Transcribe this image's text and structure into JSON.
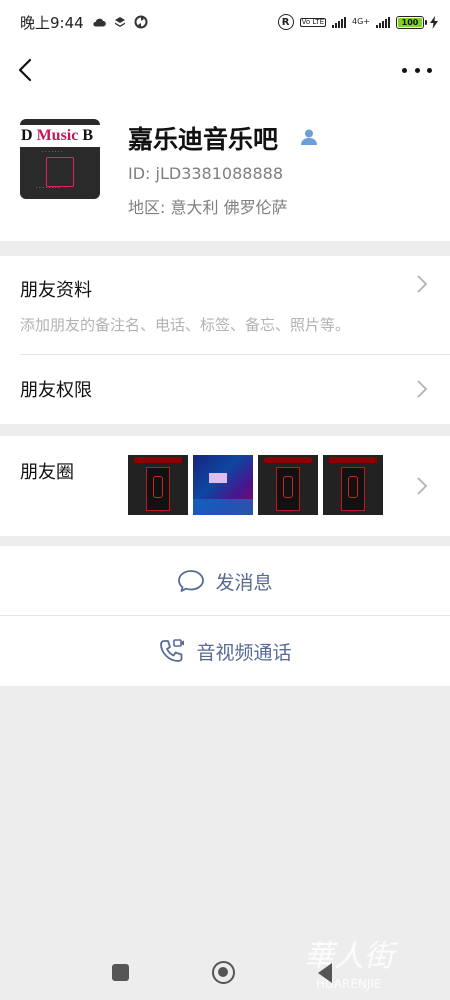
{
  "status_bar": {
    "time": "晚上9:44",
    "icons": [
      "cloud-icon",
      "layers-icon",
      "sync-icon"
    ],
    "right_icons": [
      "registered-icon",
      "volte-icon",
      "signal-icon",
      "network-4g-icon",
      "signal-icon"
    ],
    "network_label": "4G+",
    "volte_label": "Vo LTE",
    "battery": "100"
  },
  "nav": {
    "back_icon": "chevron-left-icon",
    "more_icon": "more-horizontal-icon"
  },
  "profile": {
    "avatar_logo": "D Music B",
    "name": "嘉乐迪音乐吧",
    "wechat_id": "ID: jLD3381088888",
    "region": "地区: 意大利  佛罗伦萨"
  },
  "rows": {
    "friend_info": {
      "title": "朋友资料",
      "description": "添加朋友的备注名、电话、标签、备忘、照片等。"
    },
    "friend_permissions": {
      "title": "朋友权限"
    },
    "moments": {
      "title": "朋友圈",
      "thumbnails": [
        "bar-entrance",
        "karaoke-room",
        "bar-entrance",
        "bar-entrance"
      ]
    }
  },
  "actions": {
    "message": "发消息",
    "call": "音视频通话"
  },
  "system_nav": [
    "recent-apps-icon",
    "home-icon",
    "back-icon"
  ],
  "watermark": "HUARENJIE",
  "colors": {
    "link_blue": "#576b95",
    "battery_green": "#7ed321",
    "background": "#ededed"
  }
}
